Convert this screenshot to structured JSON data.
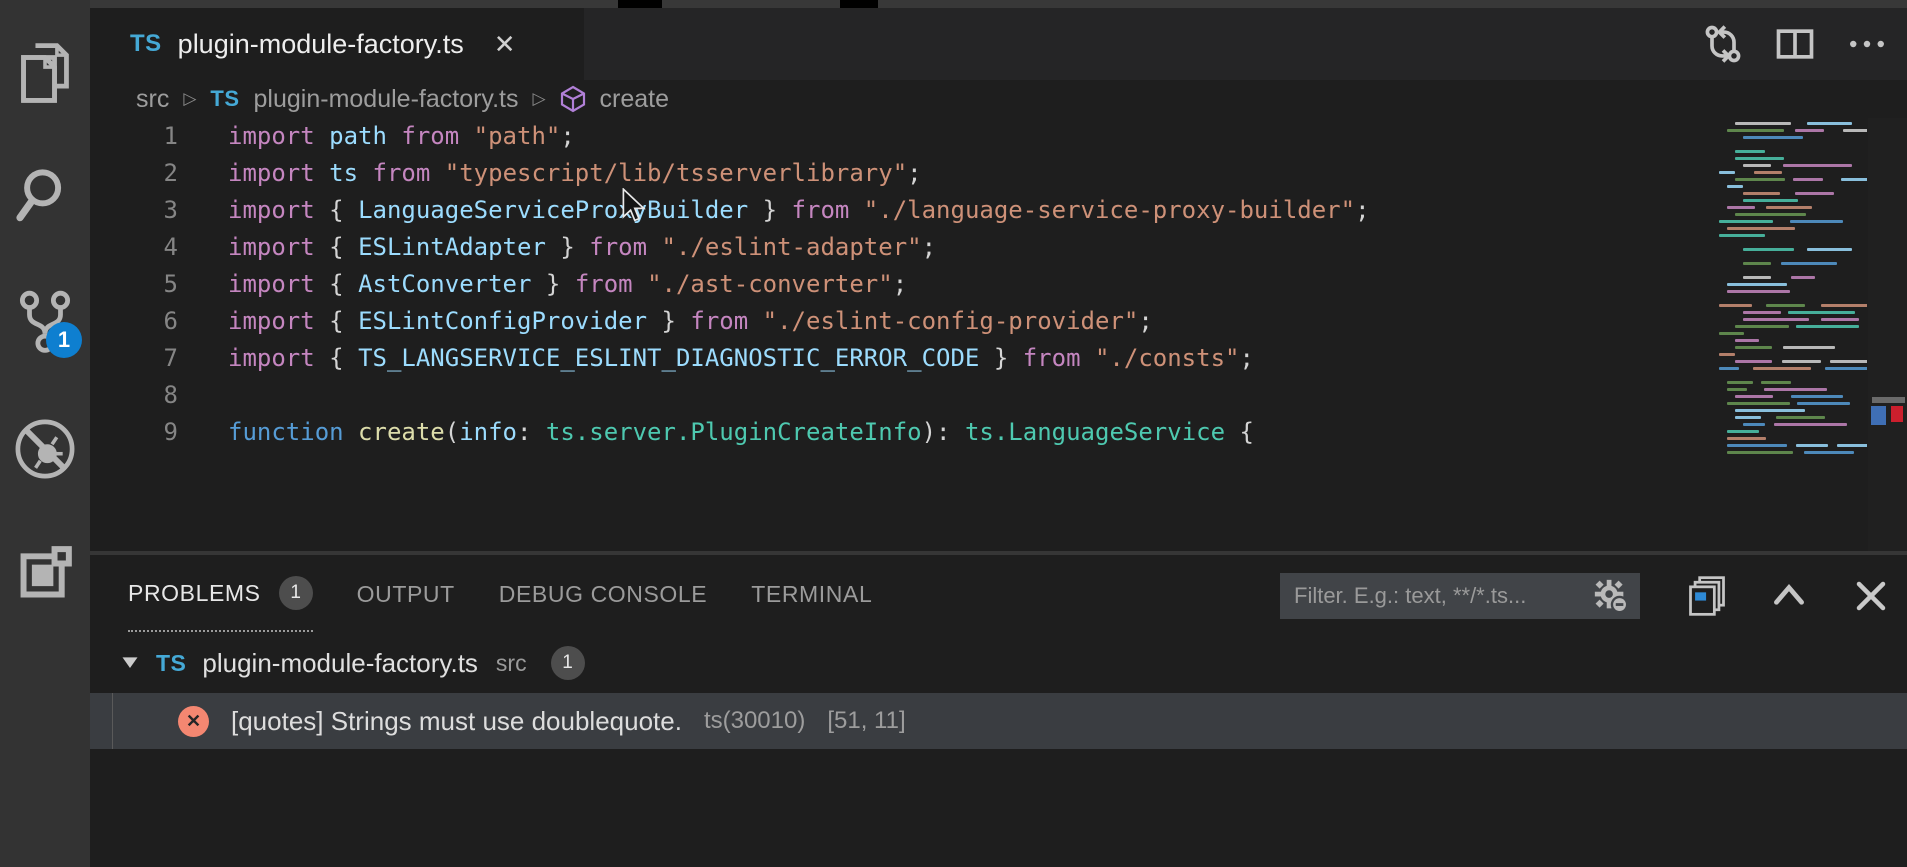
{
  "colors": {
    "accent": "#0e7fd0",
    "ts_badge": "#45a9d6",
    "error_icon_bg": "#f48771",
    "breadcrumb_symbol": "#b180d7",
    "activity_icon": "#b4b4b4"
  },
  "glyphs": {
    "close": "✕",
    "breadcrumb_separator": "▷",
    "error_x": "✕"
  },
  "activity_bar": {
    "source_control_badge": "1",
    "items": [
      "explorer",
      "search",
      "source-control",
      "debug-disabled",
      "extensions"
    ]
  },
  "tab": {
    "language_badge": "TS",
    "title": "plugin-module-factory.ts"
  },
  "breadcrumbs": {
    "root": "src",
    "file_language_badge": "TS",
    "file": "plugin-module-factory.ts",
    "symbol": "create"
  },
  "editor": {
    "lines": [
      {
        "num": "1",
        "tokens": [
          [
            "k",
            "import "
          ],
          [
            "v",
            "path "
          ],
          [
            "k",
            "from "
          ],
          [
            "s",
            "\"path\""
          ],
          [
            "p",
            ";"
          ]
        ]
      },
      {
        "num": "2",
        "tokens": [
          [
            "k",
            "import "
          ],
          [
            "v",
            "ts "
          ],
          [
            "k",
            "from "
          ],
          [
            "s",
            "\"typescript/lib/tsserverlibrary\""
          ],
          [
            "p",
            ";"
          ]
        ]
      },
      {
        "num": "3",
        "tokens": [
          [
            "k",
            "import "
          ],
          [
            "p",
            "{ "
          ],
          [
            "v",
            "LanguageServiceProxyBuilder "
          ],
          [
            "p",
            "} "
          ],
          [
            "k",
            "from "
          ],
          [
            "s",
            "\"./language-service-proxy-builder\""
          ],
          [
            "p",
            ";"
          ]
        ]
      },
      {
        "num": "4",
        "tokens": [
          [
            "k",
            "import "
          ],
          [
            "p",
            "{ "
          ],
          [
            "v",
            "ESLintAdapter "
          ],
          [
            "p",
            "} "
          ],
          [
            "k",
            "from "
          ],
          [
            "s",
            "\"./eslint-adapter\""
          ],
          [
            "p",
            ";"
          ]
        ]
      },
      {
        "num": "5",
        "tokens": [
          [
            "k",
            "import "
          ],
          [
            "p",
            "{ "
          ],
          [
            "v",
            "AstConverter "
          ],
          [
            "p",
            "} "
          ],
          [
            "k",
            "from "
          ],
          [
            "s",
            "\"./ast-converter\""
          ],
          [
            "p",
            ";"
          ]
        ]
      },
      {
        "num": "6",
        "tokens": [
          [
            "k",
            "import "
          ],
          [
            "p",
            "{ "
          ],
          [
            "v",
            "ESLintConfigProvider "
          ],
          [
            "p",
            "} "
          ],
          [
            "k",
            "from "
          ],
          [
            "s",
            "\"./eslint-config-provider\""
          ],
          [
            "p",
            ";"
          ]
        ]
      },
      {
        "num": "7",
        "tokens": [
          [
            "k",
            "import "
          ],
          [
            "p",
            "{ "
          ],
          [
            "v",
            "TS_LANGSERVICE_ESLINT_DIAGNOSTIC_ERROR_CODE "
          ],
          [
            "p",
            "} "
          ],
          [
            "k",
            "from "
          ],
          [
            "s",
            "\"./consts\""
          ],
          [
            "p",
            ";"
          ]
        ]
      },
      {
        "num": "8",
        "tokens": []
      },
      {
        "num": "9",
        "tokens": [
          [
            "b",
            "function "
          ],
          [
            "f",
            "create"
          ],
          [
            "p",
            "("
          ],
          [
            "v",
            "info"
          ],
          [
            "p",
            ": "
          ],
          [
            "t",
            "ts.server.PluginCreateInfo"
          ],
          [
            "p",
            "): "
          ],
          [
            "t",
            "ts.LanguageService"
          ],
          [
            "p",
            " {"
          ]
        ]
      }
    ]
  },
  "panel": {
    "tabs": [
      {
        "label": "PROBLEMS",
        "badge": "1",
        "active": true
      },
      {
        "label": "OUTPUT"
      },
      {
        "label": "DEBUG CONSOLE"
      },
      {
        "label": "TERMINAL"
      }
    ],
    "filter_placeholder": "Filter. E.g.: text, **/*.ts..."
  },
  "problems": {
    "file_row": {
      "language_badge": "TS",
      "file": "plugin-module-factory.ts",
      "dir": "src",
      "count": "1"
    },
    "error_row": {
      "message": "[quotes] Strings must use doublequote.",
      "source": "ts(30010)",
      "position": "[51, 11]"
    }
  }
}
